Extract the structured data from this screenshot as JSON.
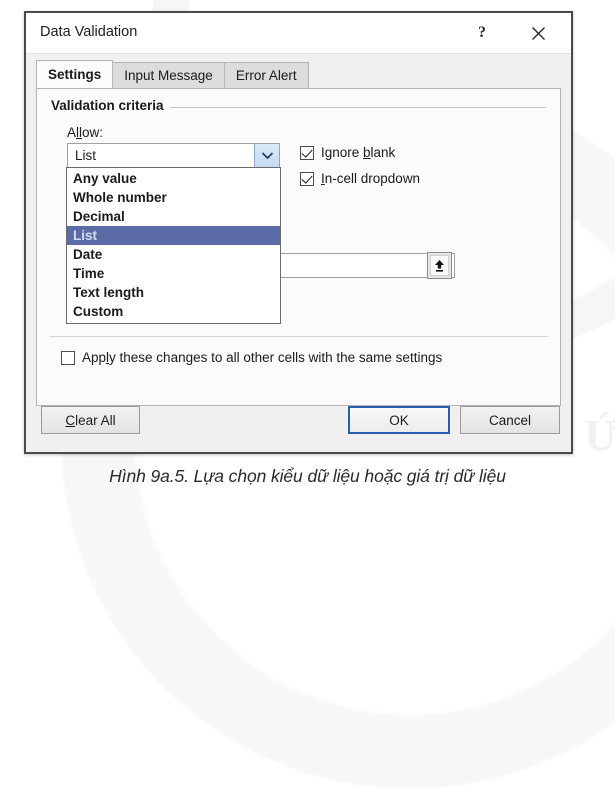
{
  "window": {
    "title": "Data Validation",
    "help_button": "?",
    "close_icon": "close-icon"
  },
  "tabs": [
    {
      "label": "Settings",
      "active": true
    },
    {
      "label": "Input Message",
      "active": false
    },
    {
      "label": "Error Alert",
      "active": false
    }
  ],
  "settings": {
    "group_title": "Validation criteria",
    "allow_label_pre": "A",
    "allow_label_acc": "ll",
    "allow_label_post": "ow:",
    "allow_value": "List",
    "dropdown_open": true,
    "dropdown_options": [
      "Any value",
      "Whole number",
      "Decimal",
      "List",
      "Date",
      "Time",
      "Text length",
      "Custom"
    ],
    "dropdown_selected": "List",
    "checkboxes": [
      {
        "name": "ignore-blank",
        "pre": "Ignore ",
        "acc": "b",
        "post": "lank",
        "checked": true
      },
      {
        "name": "in-cell-dropdown",
        "pre": "",
        "acc": "I",
        "post": "n-cell dropdown",
        "checked": true
      }
    ],
    "source_value": "",
    "range_picker_icon": "collapse-dialog-icon",
    "apply_all": {
      "pre": "App",
      "acc": "l",
      "post": "y these changes to all other cells with the same settings",
      "checked": false
    }
  },
  "footer": {
    "clear_all_pre": "",
    "clear_all_acc": "C",
    "clear_all_post": "lear All",
    "ok": "OK",
    "cancel": "Cancel"
  },
  "caption": "Hình 9a.5. Lựa chọn kiểu dữ liệu hoặc giá trị dữ liệu",
  "colors": {
    "selection_blue": "#5b6ba6",
    "focus_border": "#2a5db0",
    "dialog_bg": "#f0f0f0",
    "panel_bg": "#fbfbfb"
  }
}
